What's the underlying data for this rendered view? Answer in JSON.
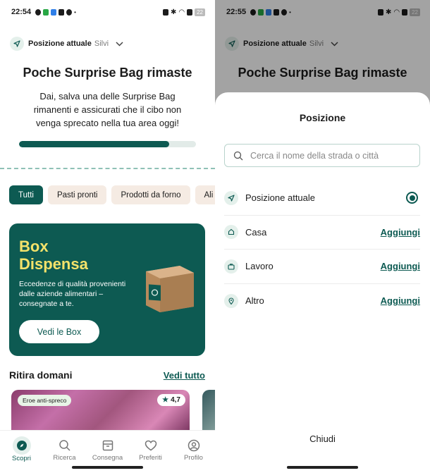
{
  "left": {
    "status": {
      "time": "22:54",
      "battery": "22"
    },
    "location": {
      "label": "Posizione attuale",
      "name": "Silvi"
    },
    "headline": "Poche Surprise Bag rimaste",
    "subtext": "Dai, salva una delle Surprise Bag rimanenti e assicurati che il cibo non venga sprecato nella tua area oggi!",
    "progress_percent": 85,
    "chips": [
      {
        "label": "Tutti"
      },
      {
        "label": "Pasti pronti"
      },
      {
        "label": "Prodotti da forno"
      },
      {
        "label": "Ali"
      }
    ],
    "promo": {
      "title_line1": "Box",
      "title_line2": "Dispensa",
      "description": "Eccedenze di qualità provenienti dalle aziende alimentari – consegnate a te.",
      "button": "Vedi le Box"
    },
    "section": {
      "title": "Ritira domani",
      "link": "Vedi tutto"
    },
    "card": {
      "badge": "Eroe anti-spreco",
      "rating": "4,7"
    },
    "nav": [
      {
        "label": "Scopri",
        "icon": "compass-icon"
      },
      {
        "label": "Ricerca",
        "icon": "search-icon"
      },
      {
        "label": "Consegna",
        "icon": "package-icon"
      },
      {
        "label": "Preferiti",
        "icon": "heart-icon"
      },
      {
        "label": "Profilo",
        "icon": "user-icon"
      }
    ]
  },
  "right": {
    "status": {
      "time": "22:55",
      "battery": "22"
    },
    "location": {
      "label": "Posizione attuale",
      "name": "Silvi"
    },
    "headline": "Poche Surprise Bag rimaste",
    "sheet": {
      "title": "Posizione",
      "search_placeholder": "Cerca il nome della strada o città",
      "items": [
        {
          "label": "Posizione attuale",
          "icon": "navigation-arrow-icon",
          "action": ""
        },
        {
          "label": "Casa",
          "icon": "home-icon",
          "action": "Aggiungi"
        },
        {
          "label": "Lavoro",
          "icon": "briefcase-icon",
          "action": "Aggiungi"
        },
        {
          "label": "Altro",
          "icon": "map-pin-icon",
          "action": "Aggiungi"
        }
      ],
      "close": "Chiudi"
    }
  },
  "colors": {
    "brand": "#0d5a52",
    "promo_title": "#f4e26a",
    "chip_bg": "#f5ebe3"
  }
}
